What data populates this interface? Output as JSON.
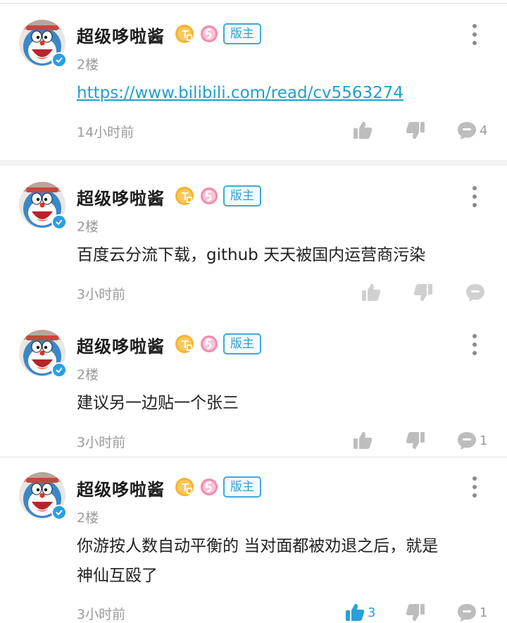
{
  "comments": [
    {
      "username": "超级哆啦酱",
      "moderator_tag": "版主",
      "floor": "2楼",
      "text": "https://www.bilibili.com/read/cv5563274",
      "is_link": true,
      "time": "14小时前",
      "like_count": "",
      "liked": false,
      "reply_count": "4"
    },
    {
      "username": "超级哆啦酱",
      "moderator_tag": "版主",
      "floor": "2楼",
      "text": "百度云分流下载，github 天天被国内运营商污染",
      "time": "3小时前",
      "like_count": "",
      "liked": false,
      "reply_count": ""
    },
    {
      "username": "超级哆啦酱",
      "moderator_tag": "版主",
      "floor": "2楼",
      "text": "建议另一边贴一个张三",
      "time": "3小时前",
      "like_count": "",
      "liked": false,
      "reply_count": "1"
    },
    {
      "username": "超级哆啦酱",
      "moderator_tag": "版主",
      "floor": "2楼",
      "text_line1": "你游按人数自动平衡的 当对面都被劝退之后，就是",
      "text_line2": "神仙互殴了",
      "time": "3小时前",
      "like_count": "3",
      "liked": true,
      "reply_count": "1"
    }
  ],
  "icons": {
    "avatar": "doraemon-avatar",
    "verified": "verified-check-icon",
    "level_badge": "gold-t-level-badge",
    "fan_badge": "pink-medal-badge",
    "more": "more-vertical-icon",
    "like": "thumb-up-icon",
    "dislike": "thumb-down-icon",
    "reply": "reply-bubble-icon"
  },
  "colors": {
    "accent_blue": "#2aa0d8",
    "link": "#1e9fcf",
    "muted_gray": "#9a9a9a",
    "gold_badge": "#f5b433",
    "pink_badge": "#f28bb0"
  }
}
